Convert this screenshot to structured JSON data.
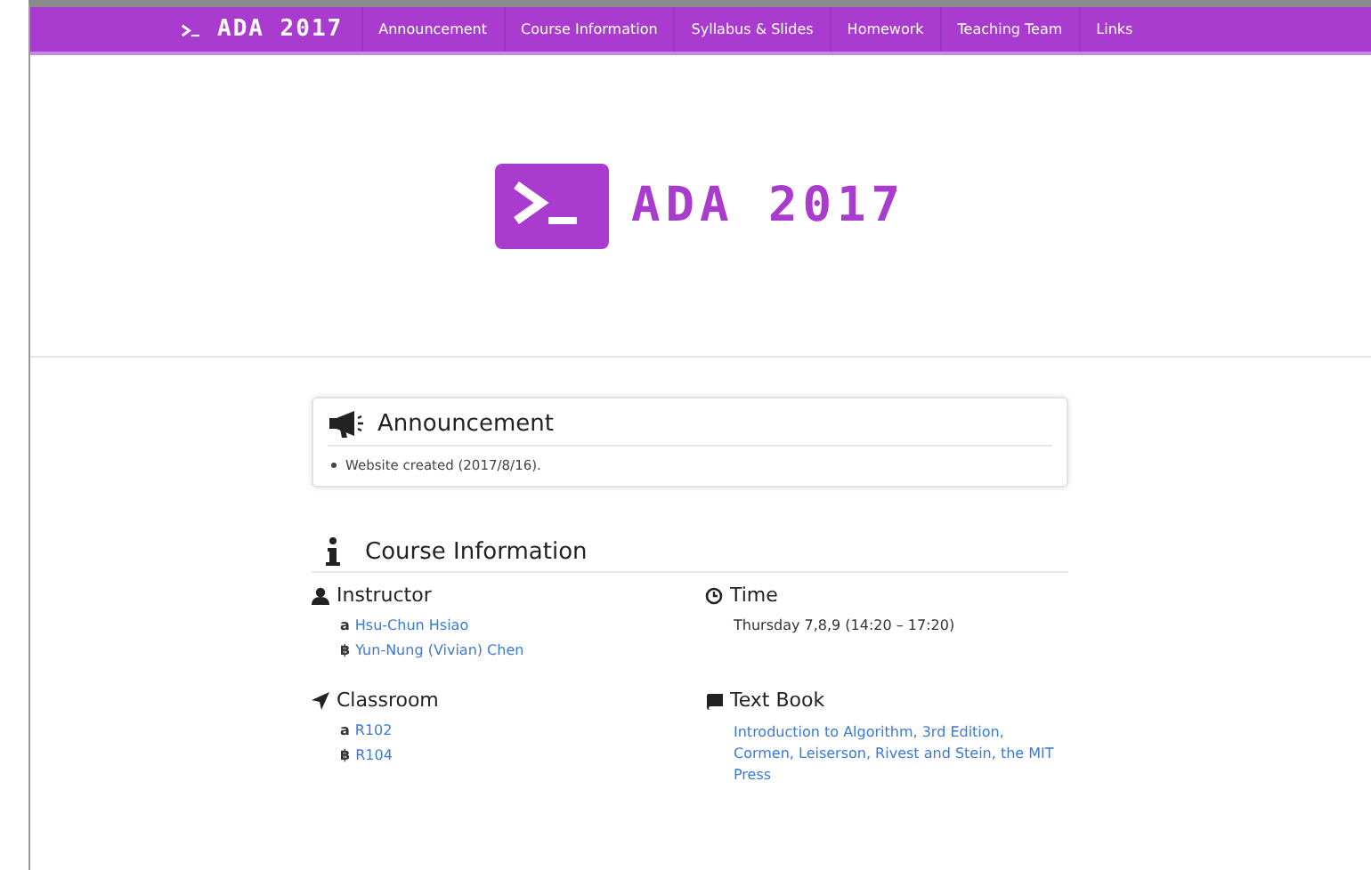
{
  "navbar": {
    "brand": "ADA 2017",
    "links": [
      {
        "label": "Announcement"
      },
      {
        "label": "Course Information"
      },
      {
        "label": "Syllabus & Slides"
      },
      {
        "label": "Homework"
      },
      {
        "label": "Teaching Team"
      },
      {
        "label": "Links"
      }
    ]
  },
  "hero": {
    "title": "ADA 2017"
  },
  "announcement": {
    "title": "Announcement",
    "items": [
      "Website created (2017/8/16)."
    ]
  },
  "course_information": {
    "title": "Course Information",
    "sections": [
      {
        "kind": "instructor",
        "title": "Instructor",
        "links": [
          {
            "marker": "a",
            "text": "Hsu-Chun Hsiao"
          },
          {
            "marker": "฿",
            "text": "Yun-Nung (Vivian) Chen"
          }
        ]
      },
      {
        "kind": "time",
        "title": "Time",
        "text": "Thursday 7,8,9 (14:20 – 17:20)"
      },
      {
        "kind": "classroom",
        "title": "Classroom",
        "links": [
          {
            "marker": "a",
            "text": "R102"
          },
          {
            "marker": "฿",
            "text": "R104"
          }
        ]
      },
      {
        "kind": "textbook",
        "title": "Text Book",
        "link": "Introduction to Algorithm, 3rd Edition, Cormen, Leiserson, Rivest and Stein, the MIT Press"
      }
    ]
  }
}
